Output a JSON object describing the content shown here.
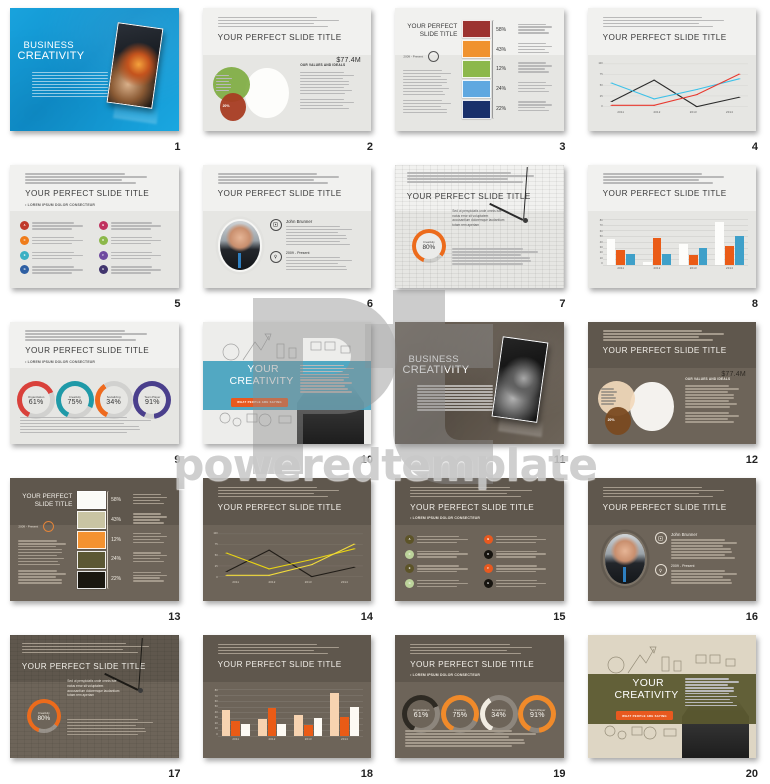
{
  "watermark": {
    "logo": "pt",
    "text": "poweredtemplate"
  },
  "common": {
    "title": "YOUR PERFECT SLIDE TITLE",
    "subtitle": "• LOREM IPSUM DOLOR CONSECTEUR",
    "values_head": "OUR VALUES AND IDEALS",
    "date_range": "2009 - Present",
    "person_name": "John Brunner",
    "money": "$77.4M",
    "pct20": "20%",
    "creativity_label": "Creativity",
    "creativity_value": "80%",
    "hero_title_line1": "BUSINESS",
    "hero_title_line2": "CREATIVITY",
    "band_title_line1": "YOUR",
    "band_title_line2": "CREATIVITY",
    "cta_label": "WHAT PEOPLE ARE SAYING",
    "quote": "Sed ut perspiciatis unde omnis iste natus error sit voluptatem accusantium doloremque laudantium totam rem aperiam"
  },
  "slides": [
    {
      "n": "1",
      "type": "hero-blue"
    },
    {
      "n": "2",
      "type": "venn-light"
    },
    {
      "n": "3",
      "type": "swatch-light"
    },
    {
      "n": "4",
      "type": "line-light"
    },
    {
      "n": "5",
      "type": "letters-light"
    },
    {
      "n": "6",
      "type": "person-light"
    },
    {
      "n": "7",
      "type": "clock-light"
    },
    {
      "n": "8",
      "type": "bars-light"
    },
    {
      "n": "9",
      "type": "rings-light"
    },
    {
      "n": "10",
      "type": "band-teal"
    },
    {
      "n": "11",
      "type": "hero-brown"
    },
    {
      "n": "12",
      "type": "venn-dark"
    },
    {
      "n": "13",
      "type": "swatch-dark"
    },
    {
      "n": "14",
      "type": "line-dark"
    },
    {
      "n": "15",
      "type": "letters-dark"
    },
    {
      "n": "16",
      "type": "person-dark"
    },
    {
      "n": "17",
      "type": "clock-dark"
    },
    {
      "n": "18",
      "type": "bars-dark"
    },
    {
      "n": "19",
      "type": "rings-dark"
    },
    {
      "n": "20",
      "type": "band-olive"
    }
  ],
  "swatch_chart": {
    "type": "bar",
    "title": "YOUR PERFECT SLIDE TITLE",
    "categories": [
      "item-1",
      "item-2",
      "item-3",
      "item-4",
      "item-5"
    ],
    "values": [
      58,
      43,
      12,
      24,
      22
    ],
    "labels": [
      "58%",
      "43%",
      "12%",
      "24%",
      "22%"
    ],
    "colors_light": [
      "#9c3230",
      "#f0922e",
      "#8cb84a",
      "#5fa8e0",
      "#19306b"
    ],
    "colors_dark": [
      "#fbfbf7",
      "#c9c4a3",
      "#f49230",
      "#5b5733",
      "#1a1710"
    ]
  },
  "chart_data": [
    {
      "type": "line",
      "title": "YOUR PERFECT SLIDE TITLE",
      "slide": "4",
      "categories": [
        "2011",
        "2012",
        "2013",
        "2014"
      ],
      "ytick_labels": [
        "100",
        "75",
        "50",
        "25",
        "0"
      ],
      "ylim": [
        0,
        100
      ],
      "grid": true,
      "series": [
        {
          "name": "series-black",
          "color": "#2b2b2b",
          "values": [
            12,
            62,
            0,
            22
          ]
        },
        {
          "name": "series-cyan",
          "color": "#3ec1e8",
          "values": [
            55,
            18,
            40,
            65
          ]
        },
        {
          "name": "series-red",
          "color": "#e8392f",
          "values": [
            3,
            3,
            28,
            76
          ]
        }
      ]
    },
    {
      "type": "line",
      "title": "YOUR PERFECT SLIDE TITLE",
      "slide": "14",
      "categories": [
        "2011",
        "2012",
        "2013",
        "2014"
      ],
      "ytick_labels": [
        "100",
        "75",
        "50",
        "25",
        "0"
      ],
      "ylim": [
        0,
        100
      ],
      "grid": true,
      "series": [
        {
          "name": "series-black",
          "color": "#211d18",
          "values": [
            12,
            62,
            0,
            22
          ]
        },
        {
          "name": "series-yellow",
          "color": "#e8d313",
          "values": [
            55,
            18,
            40,
            65
          ]
        },
        {
          "name": "series-gold",
          "color": "#f2dc3c",
          "values": [
            3,
            3,
            28,
            76
          ]
        }
      ]
    },
    {
      "type": "bar",
      "title": "YOUR PERFECT SLIDE TITLE",
      "slide": "8",
      "categories": [
        "2011",
        "2012",
        "2013",
        "2014"
      ],
      "ytick_labels": [
        "80",
        "70",
        "60",
        "50",
        "40",
        "30",
        "20",
        "10",
        "0"
      ],
      "ylim": [
        0,
        80
      ],
      "grid": true,
      "series": [
        {
          "name": "series-white",
          "color": "#fdfdfb",
          "values": [
            45,
            5,
            36,
            74
          ]
        },
        {
          "name": "series-orange",
          "color": "#ea5b16",
          "values": [
            26,
            47,
            18,
            33
          ]
        },
        {
          "name": "series-blue",
          "color": "#3fa0c9",
          "values": [
            20,
            20,
            30,
            50
          ]
        }
      ]
    },
    {
      "type": "bar",
      "title": "YOUR PERFECT SLIDE TITLE",
      "slide": "18",
      "categories": [
        "2011",
        "2012",
        "2013",
        "2014"
      ],
      "ytick_labels": [
        "80",
        "70",
        "60",
        "50",
        "40",
        "30",
        "20",
        "10",
        "0"
      ],
      "ylim": [
        0,
        80
      ],
      "grid": true,
      "series": [
        {
          "name": "series-peach",
          "color": "#f7d3b0",
          "values": [
            45,
            28,
            36,
            74
          ]
        },
        {
          "name": "series-orange",
          "color": "#ea5b16",
          "values": [
            26,
            47,
            18,
            33
          ]
        },
        {
          "name": "series-white",
          "color": "#fdfaf4",
          "values": [
            20,
            20,
            30,
            50
          ]
        }
      ]
    },
    {
      "type": "pie",
      "title": "OUR VALUES AND IDEALS",
      "slide": "2",
      "labels": [
        "green-circle",
        "white-circle",
        "red-circle"
      ],
      "values": [
        33,
        47,
        20
      ],
      "annotations": [
        "$77.4M",
        "20%"
      ],
      "colors": [
        "#7fad42",
        "#fdfdfb",
        "#a83c22"
      ]
    }
  ],
  "rings": {
    "type": "gauge",
    "items": [
      {
        "label": "Organization",
        "value": "61%",
        "pct": 61,
        "color_light": "#d9413b",
        "color_dark": "#2e2a23"
      },
      {
        "label": "Creativity",
        "value": "75%",
        "pct": 75,
        "color_light": "#1f9aa8",
        "color_dark": "#f08a2a"
      },
      {
        "label": "Socializing",
        "value": "34%",
        "pct": 34,
        "color_light": "#ee6a1e",
        "color_dark": "#f1ece2"
      },
      {
        "label": "Team Player",
        "value": "91%",
        "pct": 91,
        "color_light": "#4a3f8c",
        "color_dark": "#f08a2a"
      }
    ]
  },
  "letters": {
    "items": [
      {
        "letter": "A",
        "color_light": "#c0392b",
        "color_dark": "#5d5428"
      },
      {
        "letter": "B",
        "color_light": "#c0325f",
        "color_dark": "#e8591f"
      },
      {
        "letter": "C",
        "color_light": "#ef7c1b",
        "color_dark": "#bcd39a"
      },
      {
        "letter": "D",
        "color_light": "#8cb84a",
        "color_dark": "#17140f"
      },
      {
        "letter": "E",
        "color_light": "#3ab0c4",
        "color_dark": "#5d5428"
      },
      {
        "letter": "F",
        "color_light": "#6f4aa0",
        "color_dark": "#e8591f"
      },
      {
        "letter": "G",
        "color_light": "#2e5fa3",
        "color_dark": "#bcd39a"
      },
      {
        "letter": "H",
        "color_light": "#41356e",
        "color_dark": "#17140f"
      }
    ]
  },
  "creativity_gauge": {
    "label": "Creativity",
    "value": "80%",
    "pct": 80,
    "color": "#ec6b1c"
  }
}
